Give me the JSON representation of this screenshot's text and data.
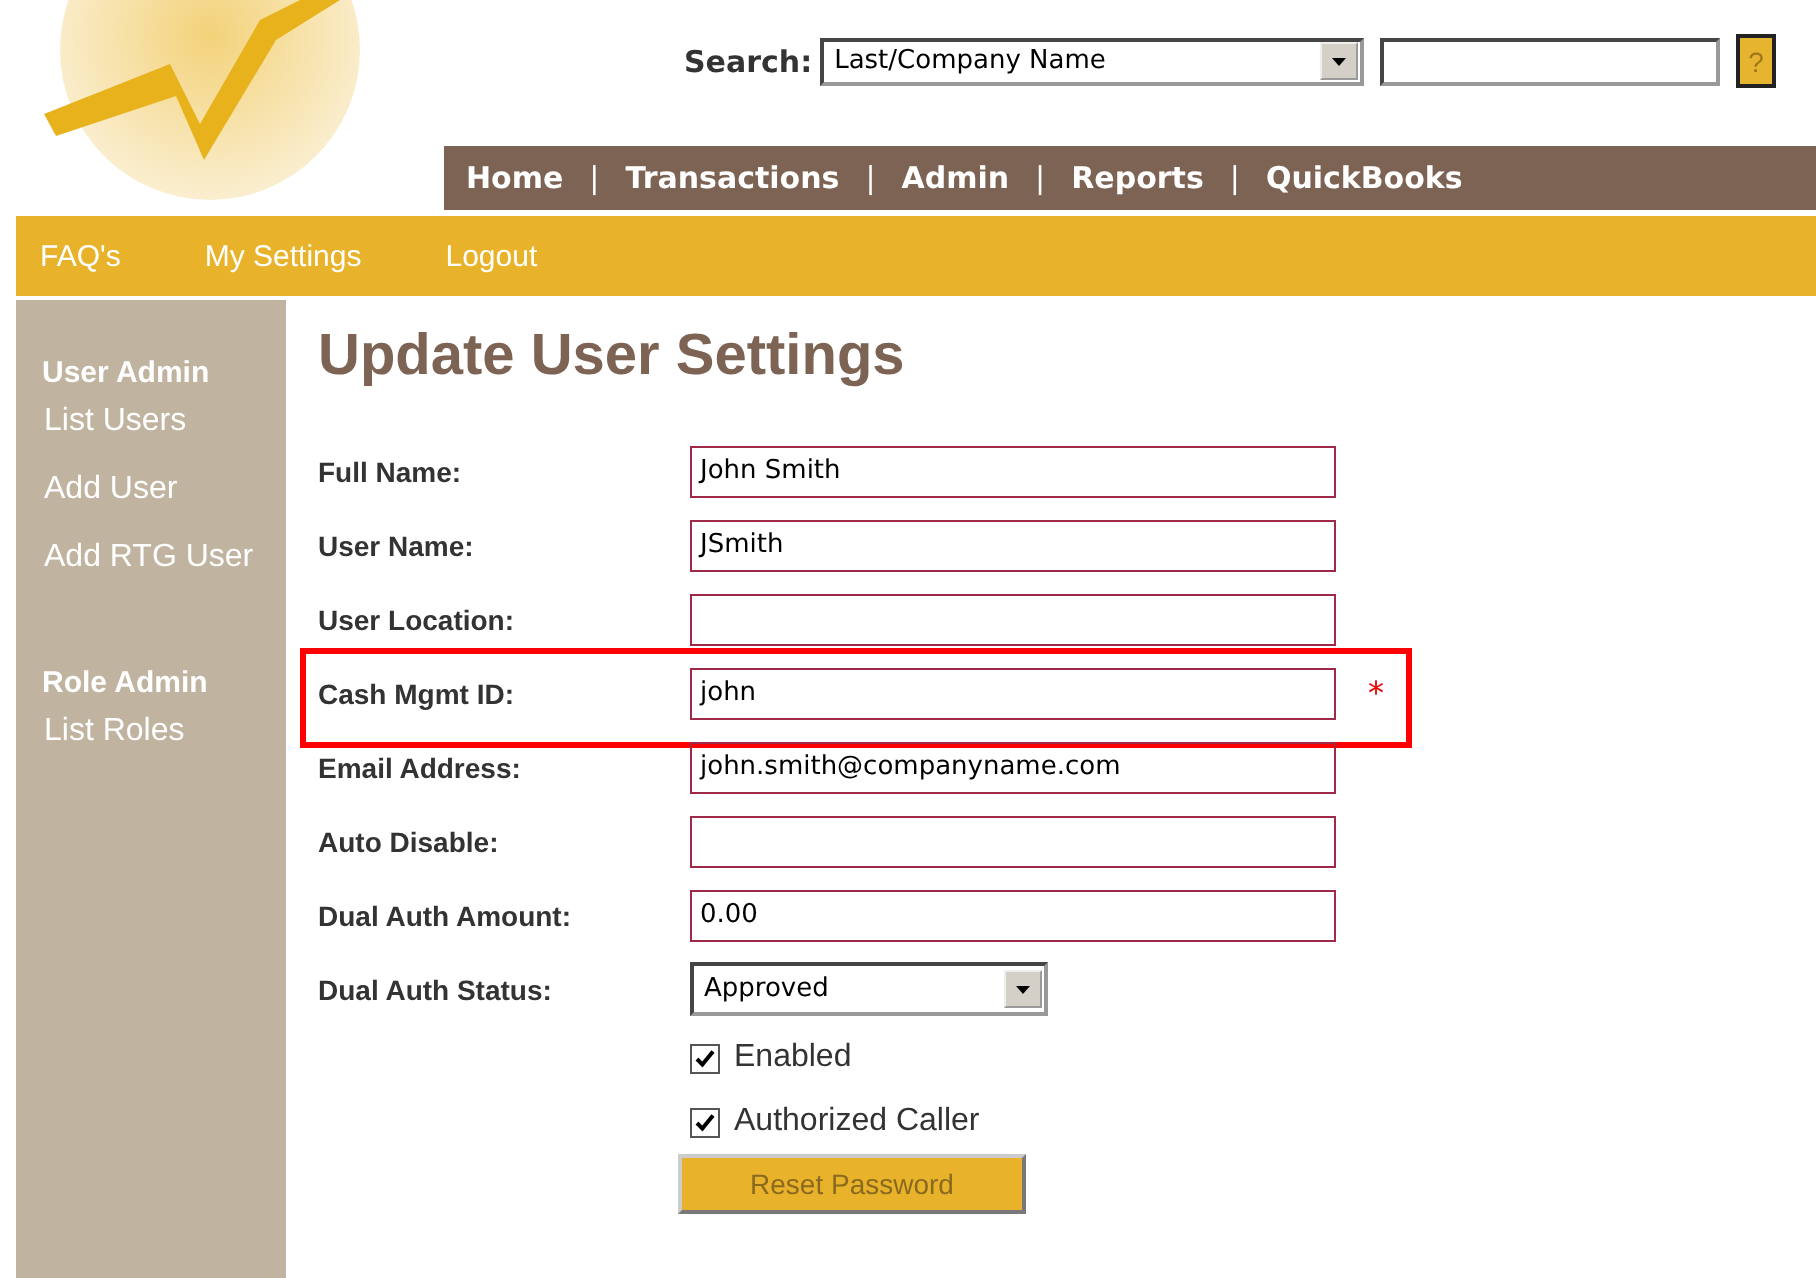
{
  "search": {
    "label": "Search:",
    "type_value": "Last/Company Name",
    "help": "?"
  },
  "nav": [
    "Home",
    "Transactions",
    "Admin",
    "Reports",
    "QuickBooks"
  ],
  "nav_separator": "|",
  "subnav": [
    "FAQ's",
    "My Settings",
    "Logout"
  ],
  "sidebar": [
    {
      "heading": "User Admin",
      "items": [
        "List Users",
        "Add User",
        "Add RTG User"
      ]
    },
    {
      "heading": "Role Admin",
      "items": [
        "List Roles"
      ]
    }
  ],
  "title": "Update User Settings",
  "fields": [
    {
      "kind": "text",
      "label": "Full Name:",
      "value": "John Smith",
      "highlighted": false
    },
    {
      "kind": "text",
      "label": "User Name:",
      "value": "JSmith",
      "highlighted": false
    },
    {
      "kind": "text",
      "label": "User Location:",
      "highlighted": false
    },
    {
      "kind": "text",
      "label": "Cash Mgmt ID:",
      "value": "john",
      "highlighted": true,
      "required_mark": "*"
    },
    {
      "kind": "text",
      "label": "Email Address:",
      "value": "john.smith@companyname.com",
      "highlighted": false
    },
    {
      "kind": "text",
      "label": "Auto Disable:",
      "highlighted": false
    },
    {
      "kind": "text",
      "label": "Dual Auth Amount:",
      "value": "0.00",
      "highlighted": false
    },
    {
      "kind": "select",
      "label": "Dual Auth Status:",
      "value": "Approved",
      "highlighted": false
    },
    {
      "kind": "checkbox",
      "label": "Enabled",
      "checked": true
    },
    {
      "kind": "checkbox",
      "label": "Authorized Caller",
      "checked": true
    }
  ],
  "button": "Reset Password"
}
